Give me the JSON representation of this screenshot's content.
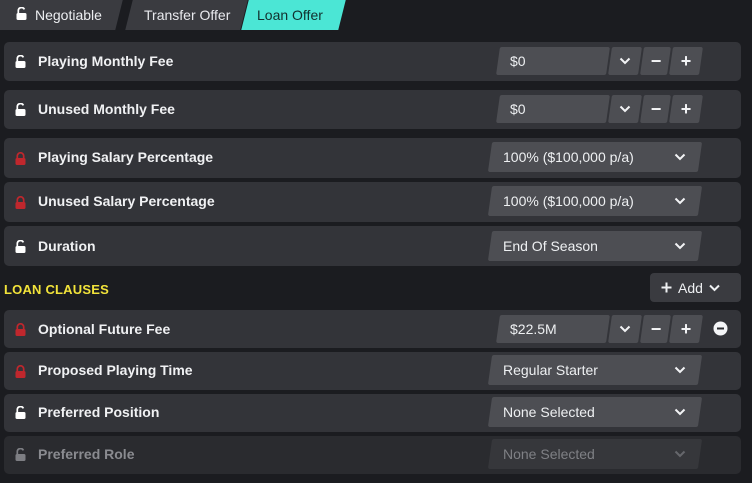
{
  "tabs": {
    "negotiable": "Negotiable",
    "transfer_offer": "Transfer Offer",
    "loan_offer": "Loan Offer",
    "active": "Loan Offer"
  },
  "rows": {
    "playing_monthly_fee": {
      "label": "Playing Monthly Fee",
      "value": "$0",
      "lock": "unlocked"
    },
    "unused_monthly_fee": {
      "label": "Unused Monthly Fee",
      "value": "$0",
      "lock": "unlocked"
    },
    "playing_salary_pct": {
      "label": "Playing Salary Percentage",
      "value": "100% ($100,000 p/a)",
      "lock": "locked"
    },
    "unused_salary_pct": {
      "label": "Unused Salary Percentage",
      "value": "100% ($100,000 p/a)",
      "lock": "locked"
    },
    "duration": {
      "label": "Duration",
      "value": "End Of Season",
      "lock": "unlocked"
    }
  },
  "loan_clauses": {
    "title": "LOAN CLAUSES",
    "add_label": "Add",
    "items": {
      "optional_future_fee": {
        "label": "Optional Future Fee",
        "value": "$22.5M",
        "lock": "locked"
      },
      "proposed_playing_time": {
        "label": "Proposed Playing Time",
        "value": "Regular Starter",
        "lock": "locked"
      },
      "preferred_position": {
        "label": "Preferred Position",
        "value": "None Selected",
        "lock": "unlocked"
      },
      "preferred_role": {
        "label": "Preferred Role",
        "value": "None Selected",
        "lock": "unlocked",
        "disabled": true
      }
    }
  },
  "colors": {
    "accent_tab": "#4be6d5",
    "section_title": "#f2e33a",
    "lock_red": "#c0272d",
    "lock_white": "#ffffff"
  }
}
